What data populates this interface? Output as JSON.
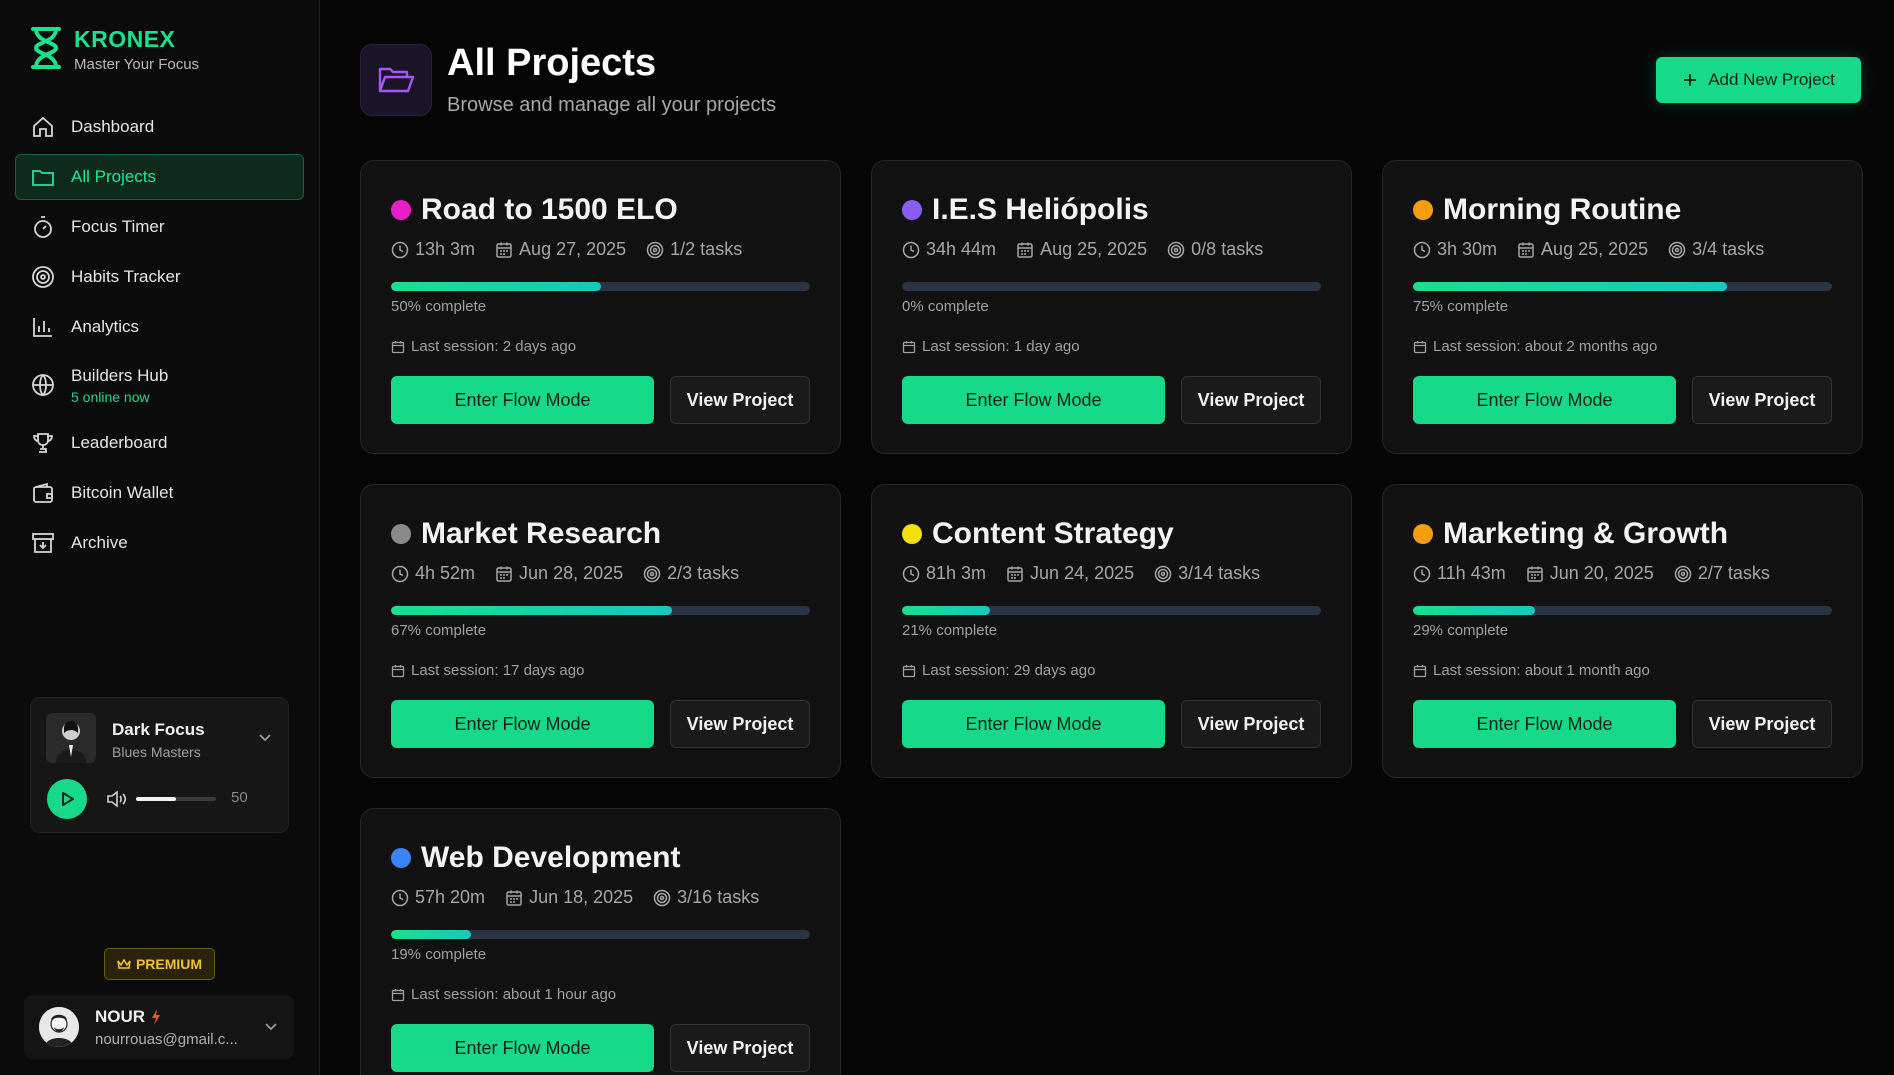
{
  "brand": {
    "name": "KRONEX",
    "tagline": "Master Your Focus",
    "accent": "#19e28f"
  },
  "nav": {
    "dashboard": "Dashboard",
    "all_projects": "All Projects",
    "focus_timer": "Focus Timer",
    "habits_tracker": "Habits Tracker",
    "analytics": "Analytics",
    "builders_hub": "Builders Hub",
    "builders_hub_sub": "5 online now",
    "leaderboard": "Leaderboard",
    "bitcoin_wallet": "Bitcoin Wallet",
    "archive": "Archive"
  },
  "player": {
    "title": "Dark Focus",
    "artist": "Blues Masters",
    "volume": "50",
    "volume_fraction": 0.5
  },
  "premium_label": "PREMIUM",
  "user": {
    "name": "NOUR",
    "email": "nourrouas@gmail.c..."
  },
  "header": {
    "title": "All Projects",
    "subtitle": "Browse and manage all your projects",
    "add_button": "Add New Project"
  },
  "buttons": {
    "flow": "Enter Flow Mode",
    "view": "View Project"
  },
  "projects": [
    {
      "name": "Road to 1500 ELO",
      "color": "#e91ec8",
      "time": "13h 3m",
      "date": "Aug 27, 2025",
      "tasks": "1/2 tasks",
      "percent": 50,
      "percent_label": "50% complete",
      "last_session": "Last session: 2 days ago"
    },
    {
      "name": "I.E.S Heliópolis",
      "color": "#8a5cf6",
      "time": "34h 44m",
      "date": "Aug 25, 2025",
      "tasks": "0/8 tasks",
      "percent": 0,
      "percent_label": "0% complete",
      "last_session": "Last session: 1 day ago"
    },
    {
      "name": "Morning Routine",
      "color": "#f59e0b",
      "time": "3h 30m",
      "date": "Aug 25, 2025",
      "tasks": "3/4 tasks",
      "percent": 75,
      "percent_label": "75% complete",
      "last_session": "Last session: about 2 months ago"
    },
    {
      "name": "Market Research",
      "color": "#8a8a8a",
      "time": "4h 52m",
      "date": "Jun 28, 2025",
      "tasks": "2/3 tasks",
      "percent": 67,
      "percent_label": "67% complete",
      "last_session": "Last session: 17 days ago"
    },
    {
      "name": "Content Strategy",
      "color": "#f5e00b",
      "time": "81h 3m",
      "date": "Jun 24, 2025",
      "tasks": "3/14 tasks",
      "percent": 21,
      "percent_label": "21% complete",
      "last_session": "Last session: 29 days ago"
    },
    {
      "name": "Marketing & Growth",
      "color": "#f59e0b",
      "time": "11h 43m",
      "date": "Jun 20, 2025",
      "tasks": "2/7 tasks",
      "percent": 29,
      "percent_label": "29% complete",
      "last_session": "Last session: about 1 month ago"
    },
    {
      "name": "Web Development",
      "color": "#3b82f6",
      "time": "57h 20m",
      "date": "Jun 18, 2025",
      "tasks": "3/16 tasks",
      "percent": 19,
      "percent_label": "19% complete",
      "last_session": "Last session: about 1 hour ago"
    }
  ]
}
